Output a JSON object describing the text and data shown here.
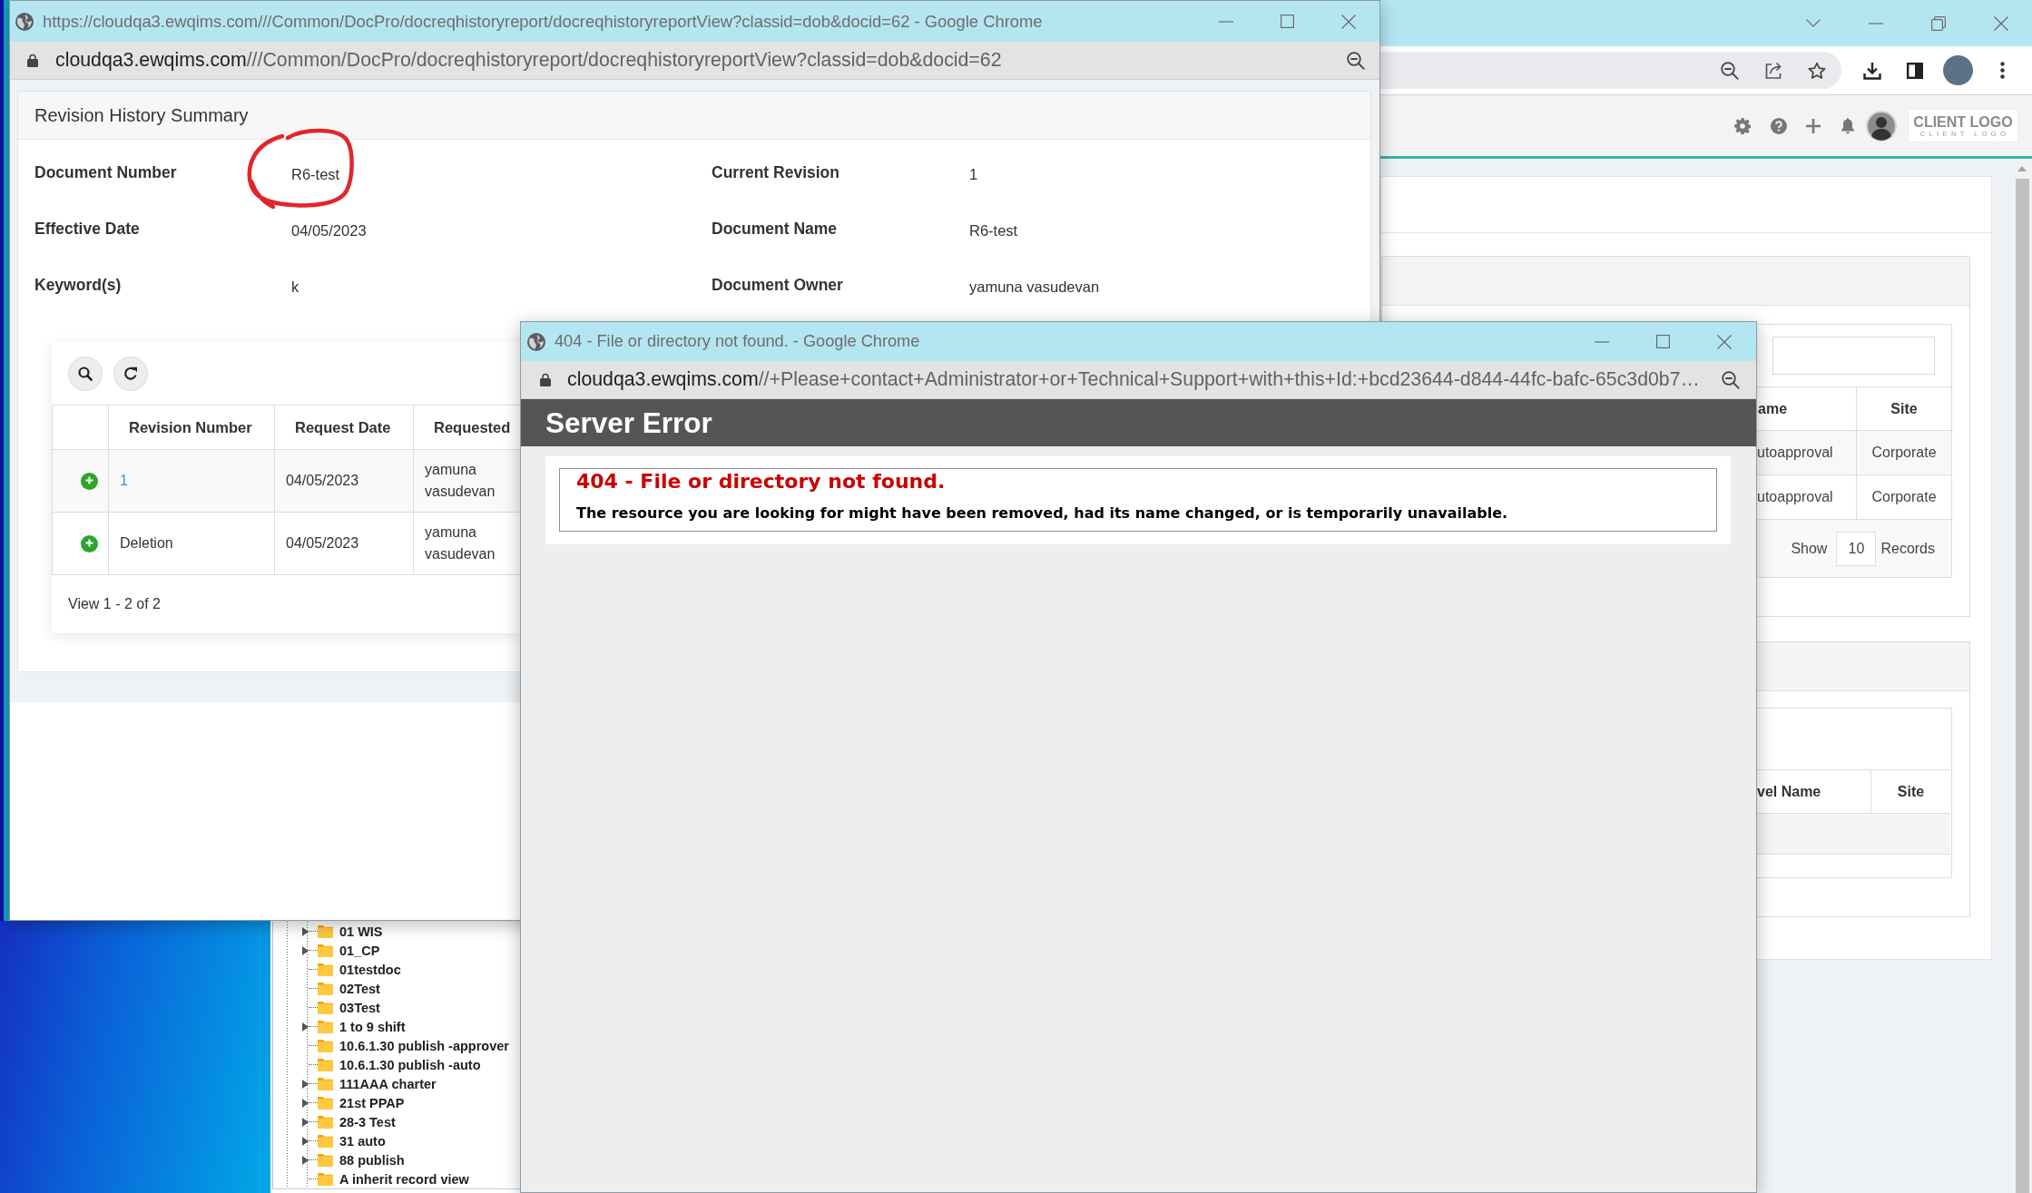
{
  "revision_window": {
    "title": "https://cloudqa3.ewqims.com///Common/DocPro/docreqhistoryreport/docreqhistoryreportView?classid=dob&docid=62 - Google Chrome",
    "url": {
      "host": "cloudqa3.ewqims.com",
      "path": "///Common/DocPro/docreqhistoryreport/docreqhistoryreportView?classid=dob&docid=62"
    },
    "panel_title": "Revision History Summary",
    "fields": [
      {
        "label": "Document Number",
        "value": "R6-test",
        "circled": true
      },
      {
        "label": "Current Revision",
        "value": "1",
        "circled": false
      },
      {
        "label": "Effective Date",
        "value": "04/05/2023",
        "circled": false
      },
      {
        "label": "Document Name",
        "value": "R6-test",
        "circled": false
      },
      {
        "label": "Keyword(s)",
        "value": "k",
        "circled": false
      },
      {
        "label": "Document Owner",
        "value": "yamuna vasudevan",
        "circled": false
      }
    ],
    "table": {
      "columns": [
        "Revision Number",
        "Request Date",
        "Requested"
      ],
      "rows": [
        {
          "revision": "1",
          "kind": "link",
          "request_date": "04/05/2023",
          "requested_by": "yamuna vasudevan"
        },
        {
          "revision": "Deletion",
          "kind": "text",
          "request_date": "04/05/2023",
          "requested_by": "yamuna vasudevan"
        }
      ]
    },
    "pager": "View 1 - 2 of 2"
  },
  "error_window": {
    "title": "404 - File or directory not found. - Google Chrome",
    "url": {
      "host": "cloudqa3.ewqims.com",
      "path": "//+Please+contact+Administrator+or+Technical+Support+with+this+Id:+bcd23644-d844-44fc-bafc-65c3d0b7…"
    },
    "banner": "Server Error",
    "heading": "404 - File or directory not found.",
    "message": "The resource you are looking for might have been removed, had its name changed, or is temporarily unavailable."
  },
  "background_browser": {
    "client_logo": {
      "title": "CLIENT LOGO",
      "tagline": "CLIENT LOGO"
    },
    "folder_tree": {
      "items": [
        {
          "label": "01 WIS",
          "expandable": true
        },
        {
          "label": "01_CP",
          "expandable": true
        },
        {
          "label": "01testdoc",
          "expandable": false
        },
        {
          "label": "02Test",
          "expandable": false
        },
        {
          "label": "03Test",
          "expandable": false
        },
        {
          "label": "1 to 9 shift",
          "expandable": true
        },
        {
          "label": "10.6.1.30 publish -approver",
          "expandable": false
        },
        {
          "label": "10.6.1.30 publish -auto",
          "expandable": false
        },
        {
          "label": "111AAA charter",
          "expandable": true
        },
        {
          "label": "21st PPAP",
          "expandable": true
        },
        {
          "label": "28-3 Test",
          "expandable": true
        },
        {
          "label": "31 auto",
          "expandable": true
        },
        {
          "label": "88 publish",
          "expandable": true
        },
        {
          "label": "A inherit record view",
          "expandable": false
        }
      ]
    },
    "approval_table": {
      "columns": [
        "ame",
        "Site"
      ],
      "rows": [
        [
          "utoapproval",
          "Corporate"
        ],
        [
          "utoapproval",
          "Corporate"
        ]
      ],
      "footer": {
        "show_label": "Show",
        "page_size": "10",
        "records_label": "Records"
      }
    },
    "level_table": {
      "columns": [
        "vel Name",
        "Site"
      ]
    }
  }
}
